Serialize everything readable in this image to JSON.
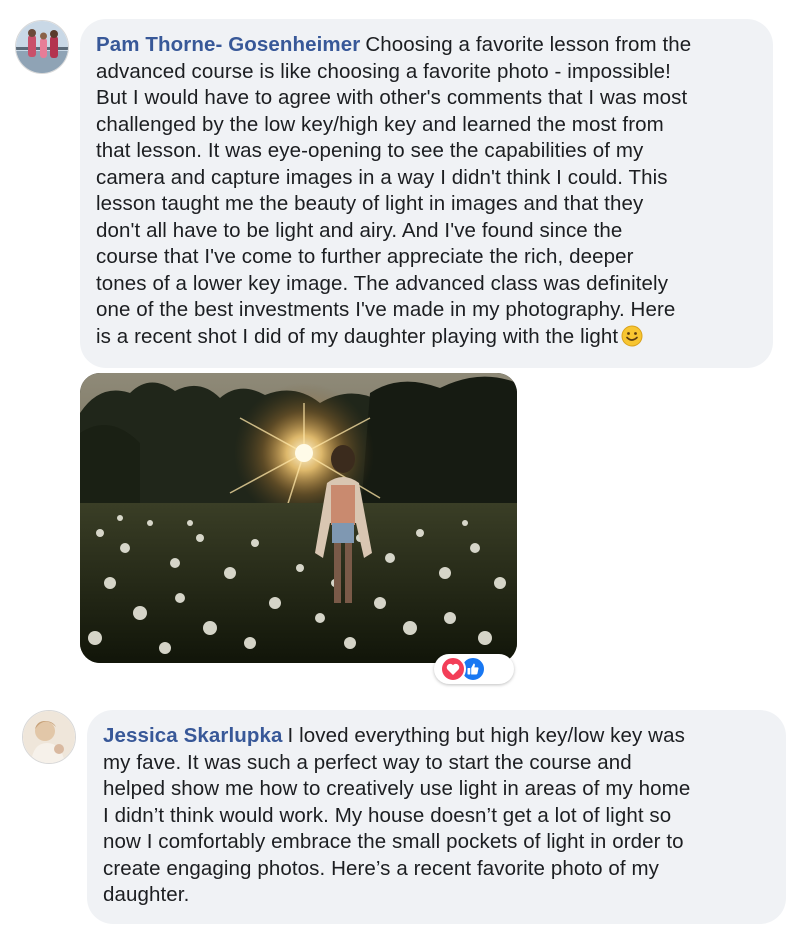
{
  "colors": {
    "author_link": "#385898",
    "bubble_bg": "#f0f2f5",
    "text": "#1c1e21",
    "love": "#f33e58",
    "like": "#1877f2"
  },
  "comments": [
    {
      "author": "Pam Thorne- Gosenheimer",
      "lines": [
        "Choosing a favorite lesson from the",
        "advanced course is like choosing a favorite photo - impossible!",
        "But I would have to agree with other's comments that I was most",
        "challenged by the low key/high key and learned the most from",
        "that lesson. It was eye-opening to see the capabilities of my",
        "camera and capture images in a way I didn't think I could. This",
        "lesson taught me the beauty of light in images and that they",
        "don't all have to be light and airy. And I've found since the",
        "course that I've come to further appreciate the rich, deeper",
        "tones of a lower key image. The advanced class was definitely",
        "one of the best investments I've made in my photography. Here",
        "is a recent shot I did of my daughter playing with the light"
      ],
      "trailing_icon": "smiley-emoji-icon",
      "attachment": "photo-girl-in-wildflower-field-at-sunset",
      "reactions": [
        "love-reaction-icon",
        "like-reaction-icon"
      ]
    },
    {
      "author": "Jessica Skarlupka",
      "lines": [
        "I loved everything but high key/low key was",
        "my fave. It was such a perfect way to start the course and",
        "helped show me how to creatively use light in areas of my home",
        "I didn’t think would work. My house doesn’t get a lot of light so",
        "now I comfortably embrace the small pockets of light in order to",
        "create engaging photos. Here’s a recent favorite photo of my",
        "daughter."
      ]
    }
  ]
}
